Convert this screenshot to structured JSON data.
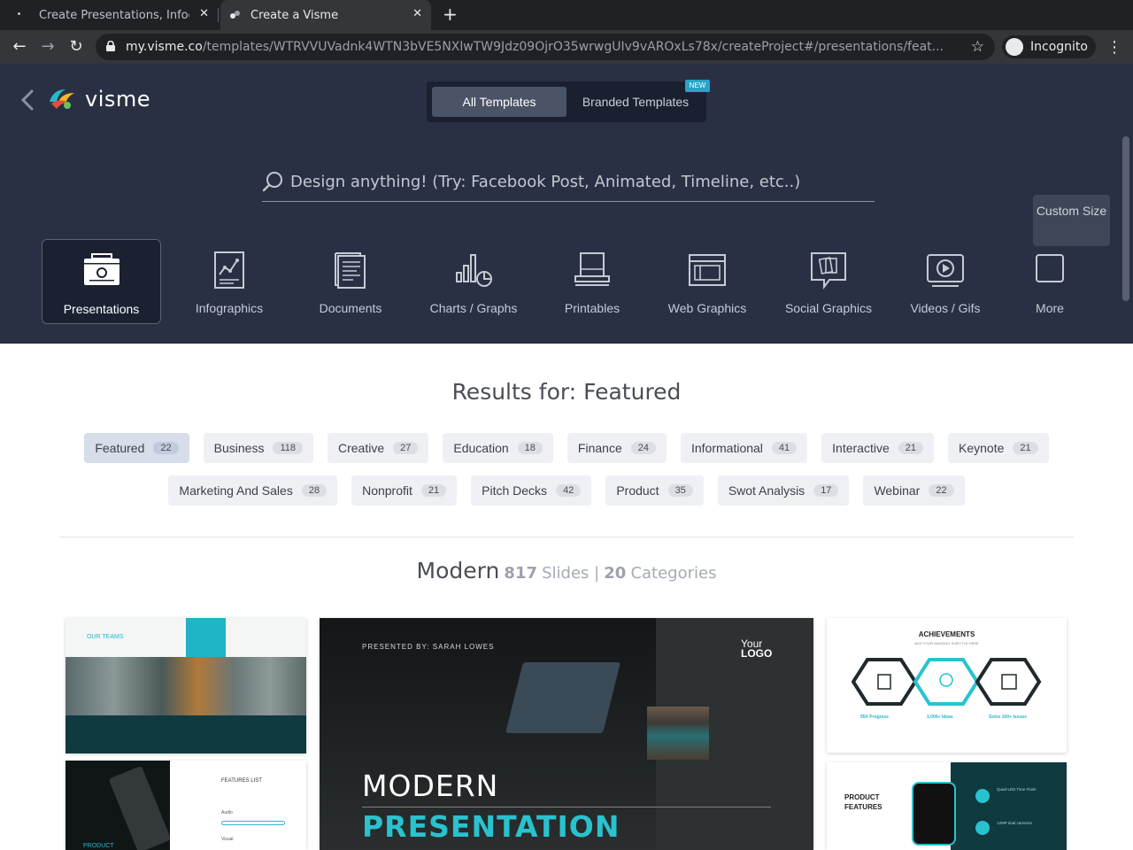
{
  "browser": {
    "tabs": [
      {
        "title": "Create Presentations, Infog"
      },
      {
        "title": "Create a Visme"
      }
    ],
    "url_host": "my.visme.co",
    "url_path": "/templates/WTRVVUVadnk4WTN3bVE5NXlwTW9Jdz09OjrO35wrwgUIv9vAROxLs78x/createProject#/presentations/feat...",
    "profile_label": "Incognito"
  },
  "header": {
    "logo_text": "visme",
    "segments": {
      "all": "All Templates",
      "branded": "Branded Templates",
      "badge": "NEW"
    },
    "search_placeholder": "Design anything! (Try: Facebook Post, Animated, Timeline, etc..)"
  },
  "categories": [
    {
      "label": "Presentations",
      "icon": "presentation-icon",
      "active": true
    },
    {
      "label": "Infographics",
      "icon": "infographic-icon"
    },
    {
      "label": "Documents",
      "icon": "document-icon"
    },
    {
      "label": "Charts / Graphs",
      "icon": "chart-icon"
    },
    {
      "label": "Printables",
      "icon": "printable-icon"
    },
    {
      "label": "Web Graphics",
      "icon": "web-graphics-icon"
    },
    {
      "label": "Social Graphics",
      "icon": "social-graphics-icon"
    },
    {
      "label": "Videos / Gifs",
      "icon": "video-icon"
    },
    {
      "label": "More",
      "icon": "more-icon"
    }
  ],
  "tooltip": "Custom Size",
  "results_title": "Results for: Featured",
  "filters_row1": [
    {
      "label": "Featured",
      "count": "22",
      "active": true
    },
    {
      "label": "Business",
      "count": "118"
    },
    {
      "label": "Creative",
      "count": "27"
    },
    {
      "label": "Education",
      "count": "18"
    },
    {
      "label": "Finance",
      "count": "24"
    },
    {
      "label": "Informational",
      "count": "41"
    },
    {
      "label": "Interactive",
      "count": "21"
    },
    {
      "label": "Keynote",
      "count": "21"
    }
  ],
  "filters_row2": [
    {
      "label": "Marketing And Sales",
      "count": "28"
    },
    {
      "label": "Nonprofit",
      "count": "21"
    },
    {
      "label": "Pitch Decks",
      "count": "42"
    },
    {
      "label": "Product",
      "count": "35"
    },
    {
      "label": "Swot Analysis",
      "count": "17"
    },
    {
      "label": "Webinar",
      "count": "22"
    }
  ],
  "collection": {
    "name": "Modern",
    "slides_num": "817",
    "slides_txt": "Slides |",
    "cats_num": "20",
    "cats_txt": "Categories"
  },
  "thumbnails": {
    "teams": {
      "title": "OUR TEAMS"
    },
    "product": {
      "list_title": "FEATURES LIST",
      "audio": "Audio",
      "visual": "Visual",
      "label": "PRODUCT"
    },
    "hero": {
      "presenter": "PRESENTED BY: SARAH LOWES",
      "logo_top": "Your",
      "logo_bottom": "LOGO",
      "line1": "MODERN",
      "line2": "PRESENTATION"
    },
    "achievements": {
      "title": "ACHIEVEMENTS",
      "subtitle": "ADD YOUR AMAZING SUBTITLE HERE",
      "stat1": "95X Progress",
      "stat2": "1,000+ Ideas",
      "stat3": "Solve 100+ Issues"
    },
    "features": {
      "title_line1": "PRODUCT",
      "title_line2": "FEATURES",
      "item1": "Quad-LED Time Flash",
      "item2": "12MP dual cameras"
    }
  },
  "colors": {
    "header_bg": "#2a3044",
    "accent": "#29b6c8",
    "text_dark": "#4a4d55"
  }
}
